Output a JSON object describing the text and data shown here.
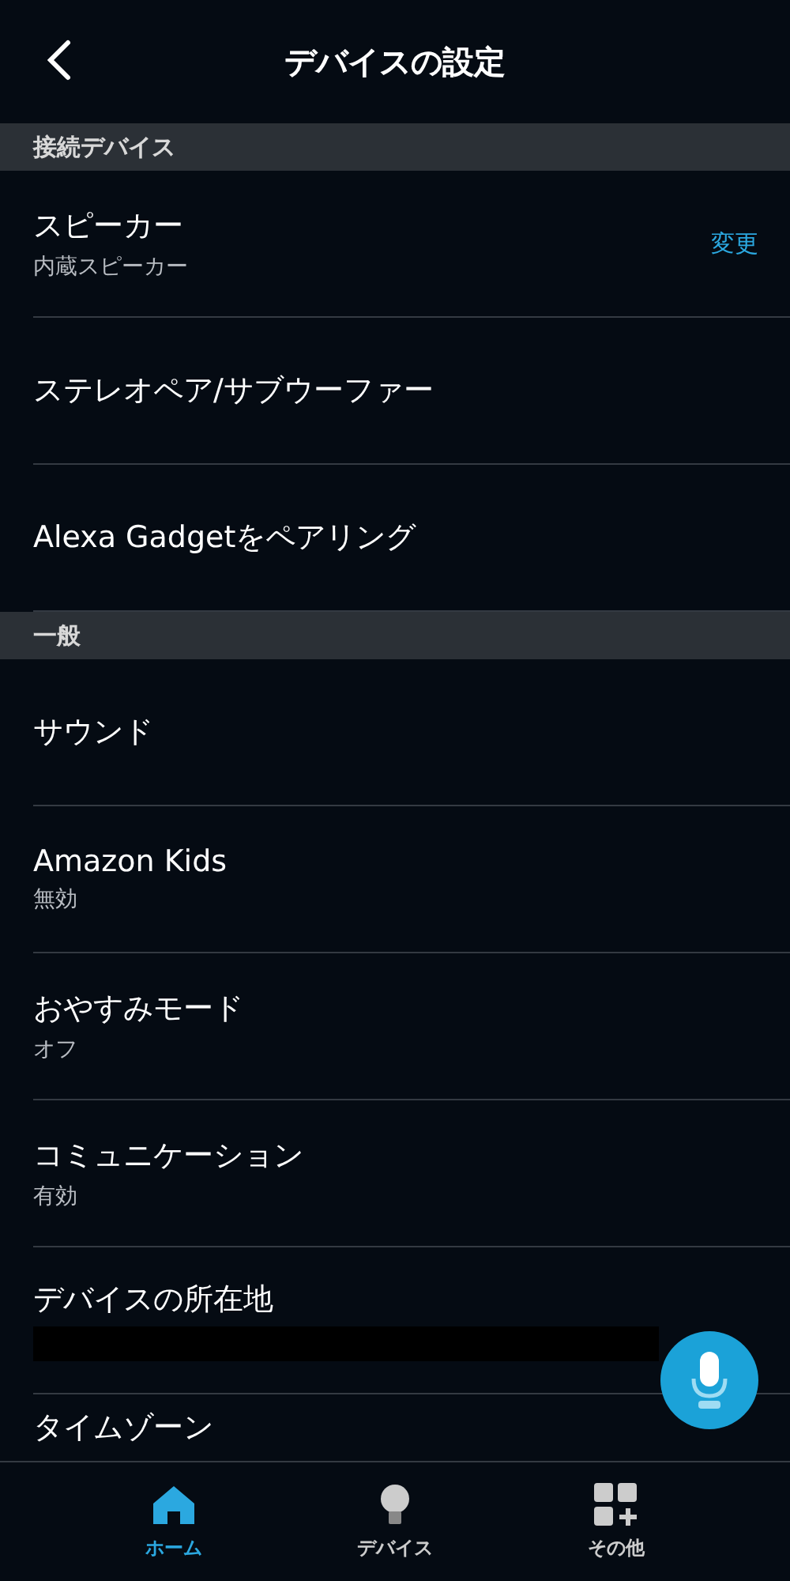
{
  "header": {
    "title": "デバイスの設定"
  },
  "sections": [
    {
      "title": "接続デバイス",
      "items": [
        {
          "label": "スピーカー",
          "subtitle": "内蔵スピーカー",
          "action": "変更"
        },
        {
          "label": "ステレオペア/サブウーファー"
        },
        {
          "label": "Alexa Gadgetをペアリング"
        }
      ]
    },
    {
      "title": "一般",
      "items": [
        {
          "label": "サウンド"
        },
        {
          "label": "Amazon Kids",
          "subtitle": "無効"
        },
        {
          "label": "おやすみモード",
          "subtitle": "オフ"
        },
        {
          "label": "コミュニケーション",
          "subtitle": "有効"
        },
        {
          "label": "デバイスの所在地",
          "redacted": true
        },
        {
          "label": "タイムゾーン"
        }
      ]
    }
  ],
  "nav": [
    {
      "kind": "home",
      "label": "ホーム",
      "selected": true
    },
    {
      "kind": "devices",
      "label": "デバイス",
      "selected": false
    },
    {
      "kind": "more",
      "label": "その他",
      "selected": false
    }
  ]
}
